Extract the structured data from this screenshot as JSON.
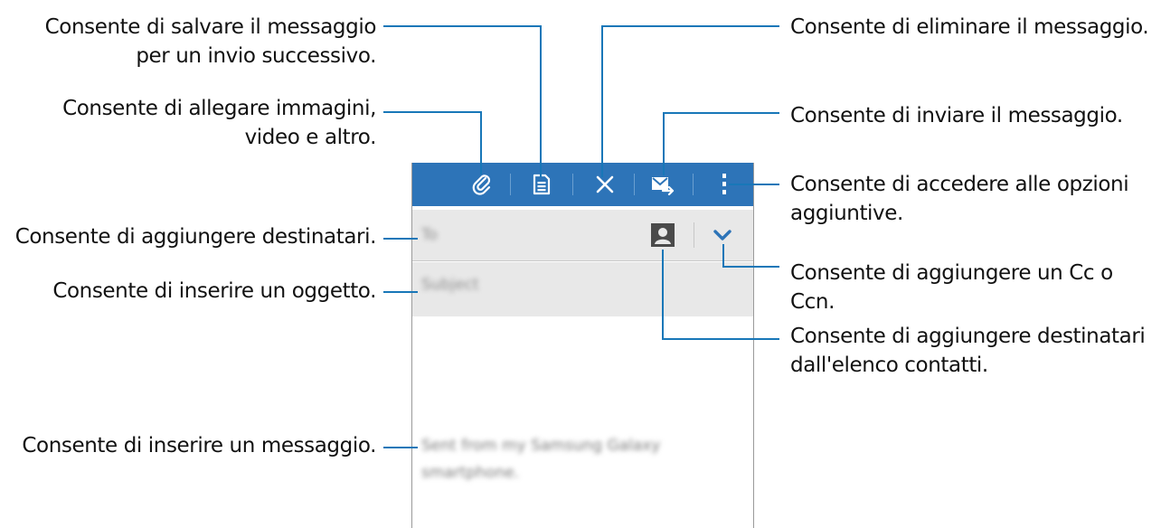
{
  "callouts": {
    "save": [
      "Consente di salvare il messaggio",
      "per un invio successivo."
    ],
    "attach": [
      "Consente di allegare immagini,",
      "video e altro."
    ],
    "add_recipients": "Consente di aggiungere destinatari.",
    "subject": "Consente di inserire un oggetto.",
    "message": "Consente di inserire un messaggio.",
    "delete": "Consente di eliminare il messaggio.",
    "send": "Consente di inviare il messaggio.",
    "options": [
      "Consente di accedere alle opzioni",
      "aggiuntive."
    ],
    "cc": [
      "Consente di aggiungere un Cc o",
      "Ccn."
    ],
    "contacts": [
      "Consente di aggiungere destinatari",
      "dall'elenco contatti."
    ]
  },
  "screen": {
    "to_placeholder": "To",
    "subject_placeholder": "Subject",
    "signature": "Sent from my Samsung Galaxy smartphone."
  },
  "icons": {
    "actionbar": [
      "paperclip-icon",
      "save-icon",
      "close-icon",
      "send-mail-icon",
      "more-options-icon"
    ],
    "fields": [
      "contact-icon",
      "chevron-down-icon"
    ]
  },
  "colors": {
    "actionbar": "#2d74b8",
    "leader_lines": "#1877b8",
    "field_background": "#e8e8e8"
  }
}
